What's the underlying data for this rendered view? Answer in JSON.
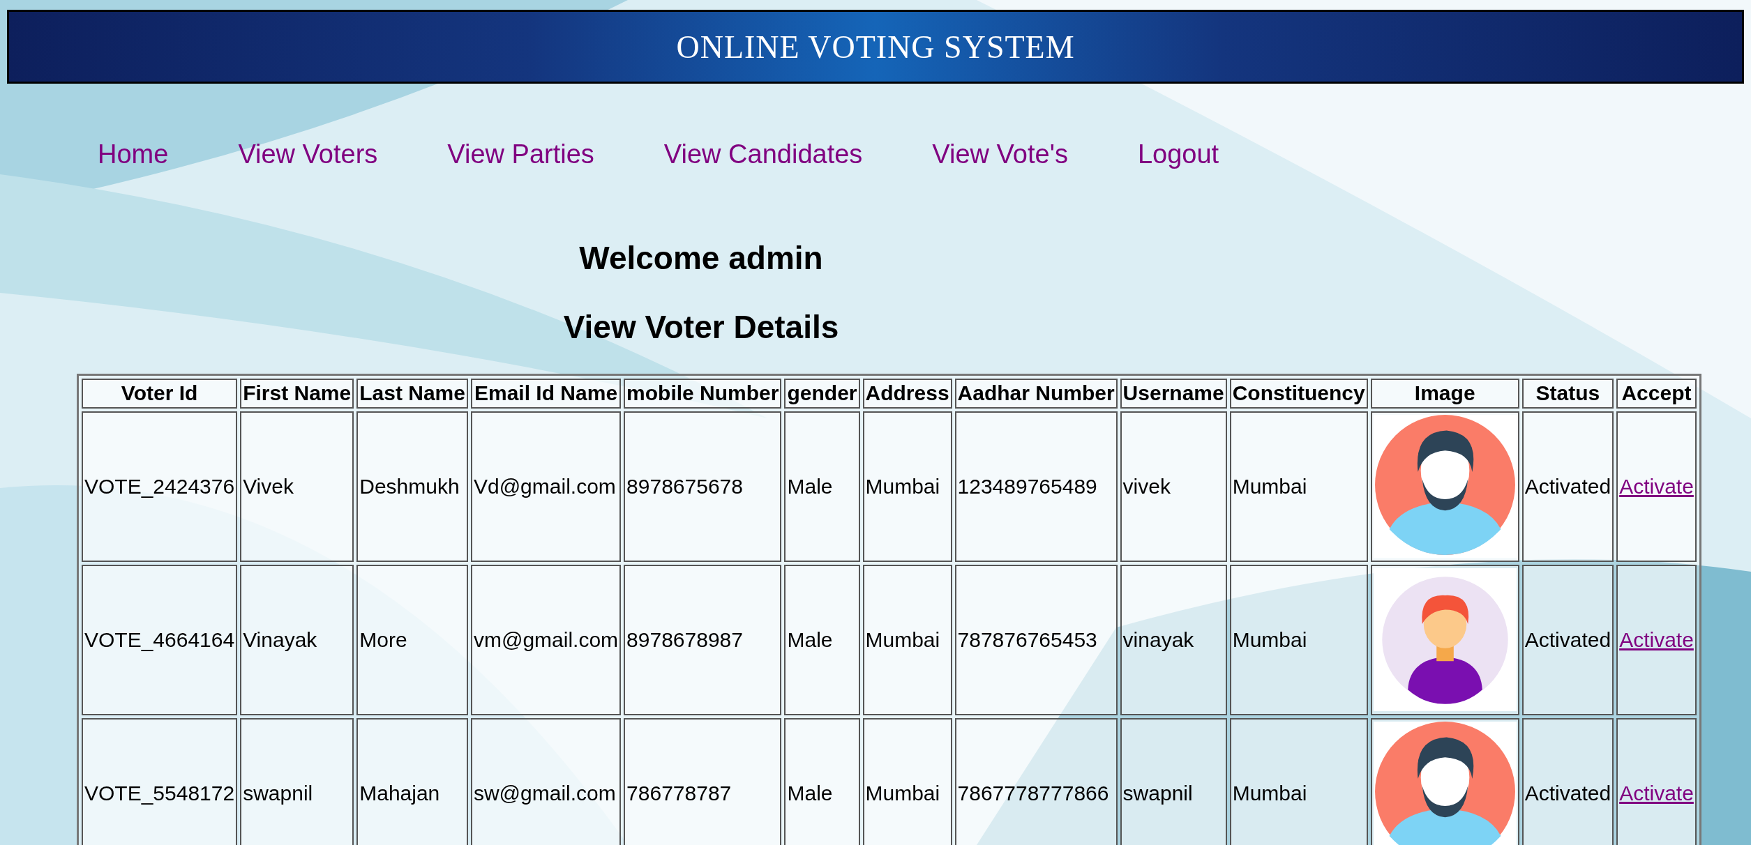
{
  "header": {
    "title": "ONLINE VOTING SYSTEM"
  },
  "nav": [
    {
      "label": "Home"
    },
    {
      "label": "View Voters"
    },
    {
      "label": "View Parties"
    },
    {
      "label": "View Candidates"
    },
    {
      "label": "View Vote's"
    },
    {
      "label": "Logout"
    }
  ],
  "welcome": "Welcome admin",
  "page_title": "View Voter Details",
  "table": {
    "columns": [
      "Voter Id",
      "First Name",
      "Last Name",
      "Email Id Name",
      "mobile Number",
      "gender",
      "Address",
      "Aadhar Number",
      "Username",
      "Constituency",
      "Image",
      "Status",
      "Accept"
    ],
    "rows": [
      {
        "cells": [
          "VOTE_2424376",
          "Vivek",
          "Deshmukh",
          "Vd@gmail.com",
          "8978675678",
          "Male",
          "Mumbai",
          "123489765489",
          "vivek",
          "Mumbai"
        ],
        "status": "Activated",
        "action": "Activate"
      },
      {
        "cells": [
          "VOTE_4664164",
          "Vinayak",
          "More",
          "vm@gmail.com",
          "8978678987",
          "Male",
          "Mumbai",
          "787876765453",
          "vinayak",
          "Mumbai"
        ],
        "status": "Activated",
        "action": "Activate"
      },
      {
        "cells": [
          "VOTE_5548172",
          "swapnil",
          "Mahajan",
          "sw@gmail.com",
          "786778787",
          "Male",
          "Mumbai",
          "7867778777866",
          "swapnil",
          "Mumbai"
        ],
        "status": "Activated",
        "action": "Activate"
      }
    ]
  }
}
